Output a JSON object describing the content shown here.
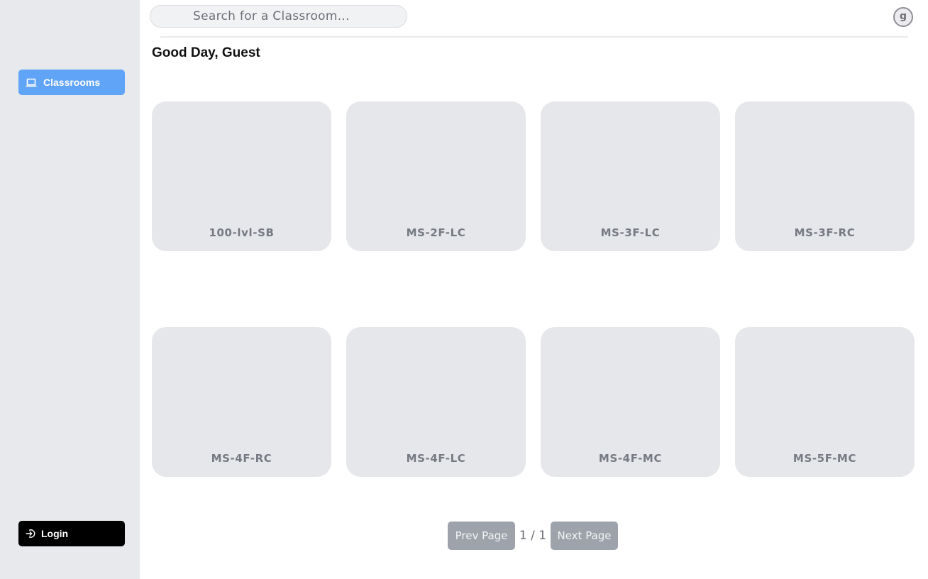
{
  "sidebar": {
    "nav_items": [
      {
        "label": "Classrooms",
        "icon": "laptop-icon",
        "active": true
      }
    ],
    "login": {
      "label": "Login",
      "icon": "login-icon"
    }
  },
  "header": {
    "search": {
      "placeholder": "Search for a Classroom...",
      "value": ""
    },
    "avatar_initial": "g"
  },
  "main": {
    "greeting": "Good Day, Guest",
    "classrooms": [
      {
        "name": "100-lvl-SB"
      },
      {
        "name": "MS-2F-LC"
      },
      {
        "name": "MS-3F-LC"
      },
      {
        "name": "MS-3F-RC"
      },
      {
        "name": "MS-4F-RC"
      },
      {
        "name": "MS-4F-LC"
      },
      {
        "name": "MS-4F-MC"
      },
      {
        "name": "MS-5F-MC"
      }
    ],
    "pagination": {
      "prev_label": "Prev Page",
      "indicator": "1 / 1",
      "next_label": "Next Page"
    }
  },
  "colors": {
    "sidebar_bg": "#e8e9ec",
    "accent": "#5fa4f7",
    "card_bg": "#e6e7ea",
    "login_bg": "#000000",
    "pagination_btn": "#9ea3ab"
  }
}
